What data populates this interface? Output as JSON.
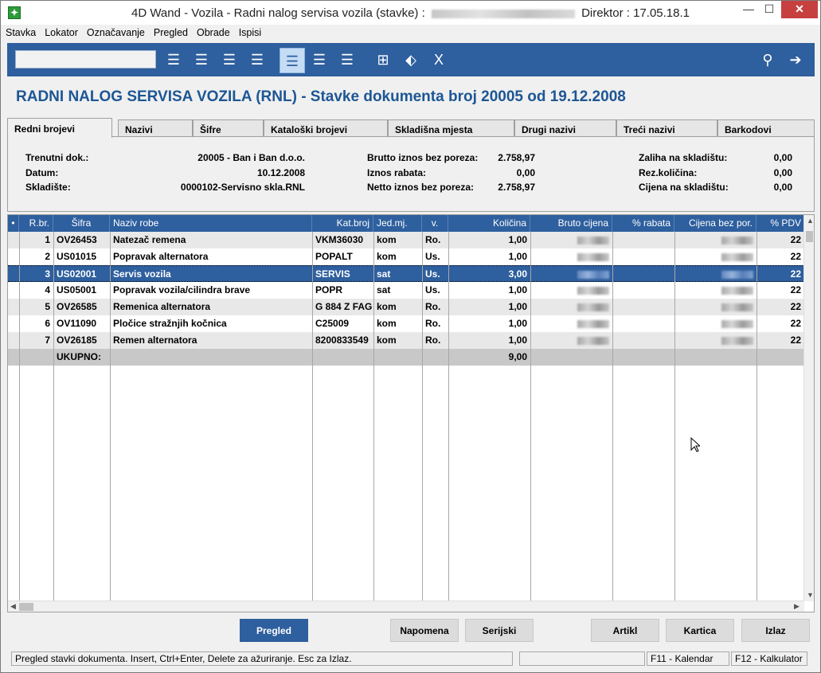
{
  "window": {
    "title_prefix": "4D Wand - Vozila - Radni nalog servisa vozila (stavke) :",
    "title_suffix": "Direktor : 17.05.18.1",
    "minimize": "—",
    "maximize": "☐",
    "close": "✕"
  },
  "menu": [
    "Stavka",
    "Lokator",
    "Označavanje",
    "Pregled",
    "Obrade",
    "Ispisi"
  ],
  "toolbar": {
    "search_value": "",
    "icons": [
      "rows-add-icon",
      "rows-insert-icon",
      "rows-delete-icon",
      "rows-refresh-icon",
      "view-wide-icon",
      "view-medium-icon",
      "view-narrow-icon",
      "tree-icon",
      "tag-icon",
      "excel-icon",
      "filter-icon",
      "exit-icon"
    ]
  },
  "heading": "RADNI NALOG SERVISA VOZILA (RNL) - Stavke dokumenta broj 20005 od 19.12.2008",
  "tabs": [
    "Redni brojevi",
    "Nazivi",
    "Šifre",
    "Kataloški brojevi",
    "Skladišna mjesta",
    "Drugi nazivi",
    "Treći nazivi",
    "Barkodovi"
  ],
  "info": {
    "trenutni_label": "Trenutni dok.:",
    "trenutni_value": "20005 - Ban i Ban d.o.o.",
    "datum_label": "Datum:",
    "datum_value": "10.12.2008",
    "skladiste_label": "Skladište:",
    "skladiste_value": "0000102-Servisno skla.RNL",
    "brutto_label": "Brutto iznos bez poreza:",
    "brutto_value": "2.758,97",
    "rabat_label": "Iznos rabata:",
    "rabat_value": "0,00",
    "netto_label": "Netto iznos bez poreza:",
    "netto_value": "2.758,97",
    "zaliha_label": "Zaliha na skladištu:",
    "zaliha_value": "0,00",
    "rezkol_label": "Rez.količina:",
    "rezkol_value": "0,00",
    "cijena_label": "Cijena na skladištu:",
    "cijena_value": "0,00"
  },
  "grid": {
    "headers": [
      "•",
      "R.br.",
      "Šifra",
      "Naziv robe",
      "Kat.broj",
      "Jed.mj.",
      "v.",
      "Količina",
      "Bruto cijena",
      "% rabata",
      "Cijena bez por.",
      "% PDV"
    ],
    "rows": [
      {
        "rbr": "1",
        "sifra": "OV26453",
        "naziv": "Natezač remena",
        "katbroj": "VKM36030",
        "jedmj": "kom",
        "v": "Ro.",
        "kolicina": "1,00",
        "pdv": "22"
      },
      {
        "rbr": "2",
        "sifra": "US01015",
        "naziv": "Popravak alternatora",
        "katbroj": "POPALT",
        "jedmj": "kom",
        "v": "Us.",
        "kolicina": "1,00",
        "pdv": "22"
      },
      {
        "rbr": "3",
        "sifra": "US02001",
        "naziv": "Servis vozila",
        "katbroj": "SERVIS",
        "jedmj": "sat",
        "v": "Us.",
        "kolicina": "3,00",
        "pdv": "22"
      },
      {
        "rbr": "4",
        "sifra": "US05001",
        "naziv": "Popravak vozila/cilindra brave",
        "katbroj": "POPR",
        "jedmj": "sat",
        "v": "Us.",
        "kolicina": "1,00",
        "pdv": "22"
      },
      {
        "rbr": "5",
        "sifra": "OV26585",
        "naziv": "Remenica alternatora",
        "katbroj": "G 884 Z FAG",
        "jedmj": "kom",
        "v": "Ro.",
        "kolicina": "1,00",
        "pdv": "22"
      },
      {
        "rbr": "6",
        "sifra": "OV11090",
        "naziv": "Pločice stražnjih kočnica",
        "katbroj": "C25009",
        "jedmj": "kom",
        "v": "Ro.",
        "kolicina": "1,00",
        "pdv": "22"
      },
      {
        "rbr": "7",
        "sifra": "OV26185",
        "naziv": "Remen alternatora",
        "katbroj": "8200833549",
        "jedmj": "kom",
        "v": "Ro.",
        "kolicina": "1,00",
        "pdv": "22"
      }
    ],
    "selected_index": 2,
    "total_label": "UKUPNO:",
    "total_kolicina": "9,00"
  },
  "buttons": {
    "pregled": "Pregled",
    "napomena": "Napomena",
    "serijski": "Serijski",
    "artikl": "Artikl",
    "kartica": "Kartica",
    "izlaz": "Izlaz"
  },
  "status": {
    "message": "Pregled stavki dokumenta. Insert, Ctrl+Enter, Delete za ažuriranje. Esc za Izlaz.",
    "f11": "F11 - Kalendar",
    "f12": "F12 - Kalkulator"
  }
}
